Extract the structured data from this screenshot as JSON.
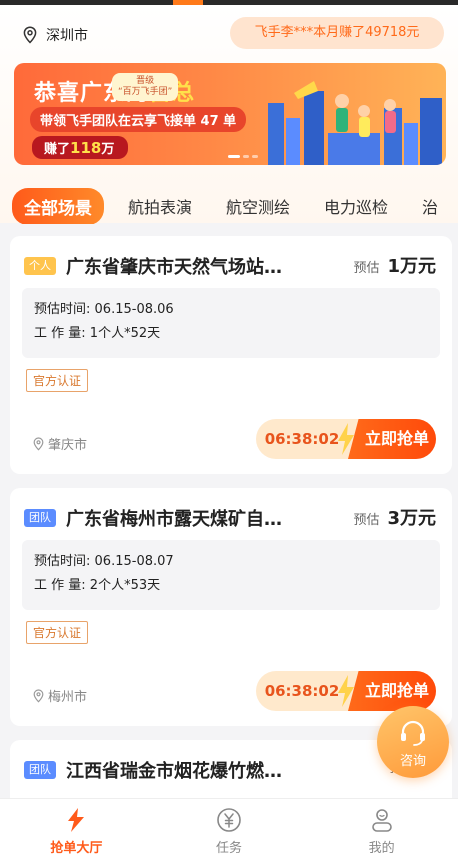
{
  "header": {
    "city": "深圳市",
    "earnings_ticker": "飞手李***本月赚了49718元"
  },
  "banner": {
    "title_prefix": "恭喜广东的",
    "title_highlight": "雷总",
    "subtitle": "带领飞手团队在云享飞接单 47 单",
    "earned_prefix": "赚了",
    "earned_amount": "118",
    "earned_unit": "万",
    "badge_line1": "晋级",
    "badge_line2": "“百万飞手团”"
  },
  "tabs": {
    "items": [
      "全部场景",
      "航拍表演",
      "航空测绘",
      "电力巡检"
    ],
    "overflow_label": "治"
  },
  "orders": [
    {
      "tag": "个人",
      "title": "广东省肇庆市天然气场站…",
      "estimate_label": "预估",
      "estimate_value": "1万元",
      "time_label": "预估时间:",
      "time_value": "06.15-08.06",
      "workload_label": "工 作 量:",
      "workload_value": "1个人*52天",
      "certification": "官方认证",
      "city": "肇庆市",
      "countdown": "06:38:02",
      "action": "立即抢单"
    },
    {
      "tag": "团队",
      "title": "广东省梅州市露天煤矿自…",
      "estimate_label": "预估",
      "estimate_value": "3万元",
      "time_label": "预估时间:",
      "time_value": "06.15-08.07",
      "workload_label": "工 作 量:",
      "workload_value": "2个人*53天",
      "certification": "官方认证",
      "city": "梅州市",
      "countdown": "06:38:02",
      "action": "立即抢单"
    },
    {
      "tag": "团队",
      "title": "江西省瑞金市烟花爆竹燃…",
      "estimate_label": "预估",
      "estimate_value": "3"
    }
  ],
  "consult": {
    "label": "咨询"
  },
  "bottom_nav": [
    {
      "label": "抢单大厅",
      "icon": "lightning-icon"
    },
    {
      "label": "任务",
      "icon": "yen-coin-icon"
    },
    {
      "label": "我的",
      "icon": "profile-icon"
    }
  ],
  "colors": {
    "accent": "#ff5a1a",
    "timer_bg": "#ffe9cc",
    "person_tag": "#ffc44d",
    "team_tag": "#5b8cff"
  }
}
